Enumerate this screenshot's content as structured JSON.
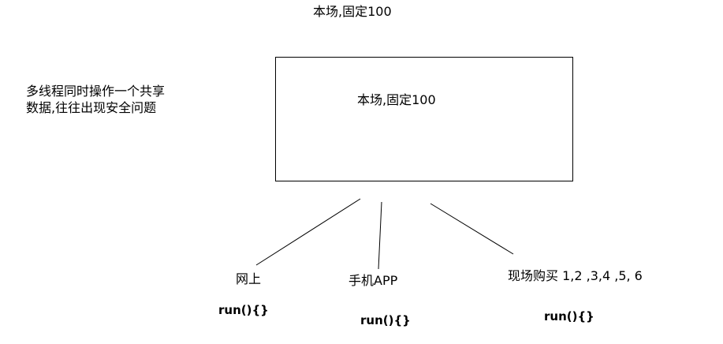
{
  "diagram": {
    "top_title": "本场,固定100",
    "side_note_line1": "多线程同时操作一个共享",
    "side_note_line2": "数据,往往出现安全问题",
    "box_label": "本场,固定100",
    "channels": [
      {
        "label": "网上",
        "code": "run(){}"
      },
      {
        "label": "手机APP",
        "code": "run(){}"
      },
      {
        "label": "现场购买  1,2 ,3,4 ,5, 6",
        "code": "run(){}"
      }
    ],
    "line_color": "#000000"
  }
}
